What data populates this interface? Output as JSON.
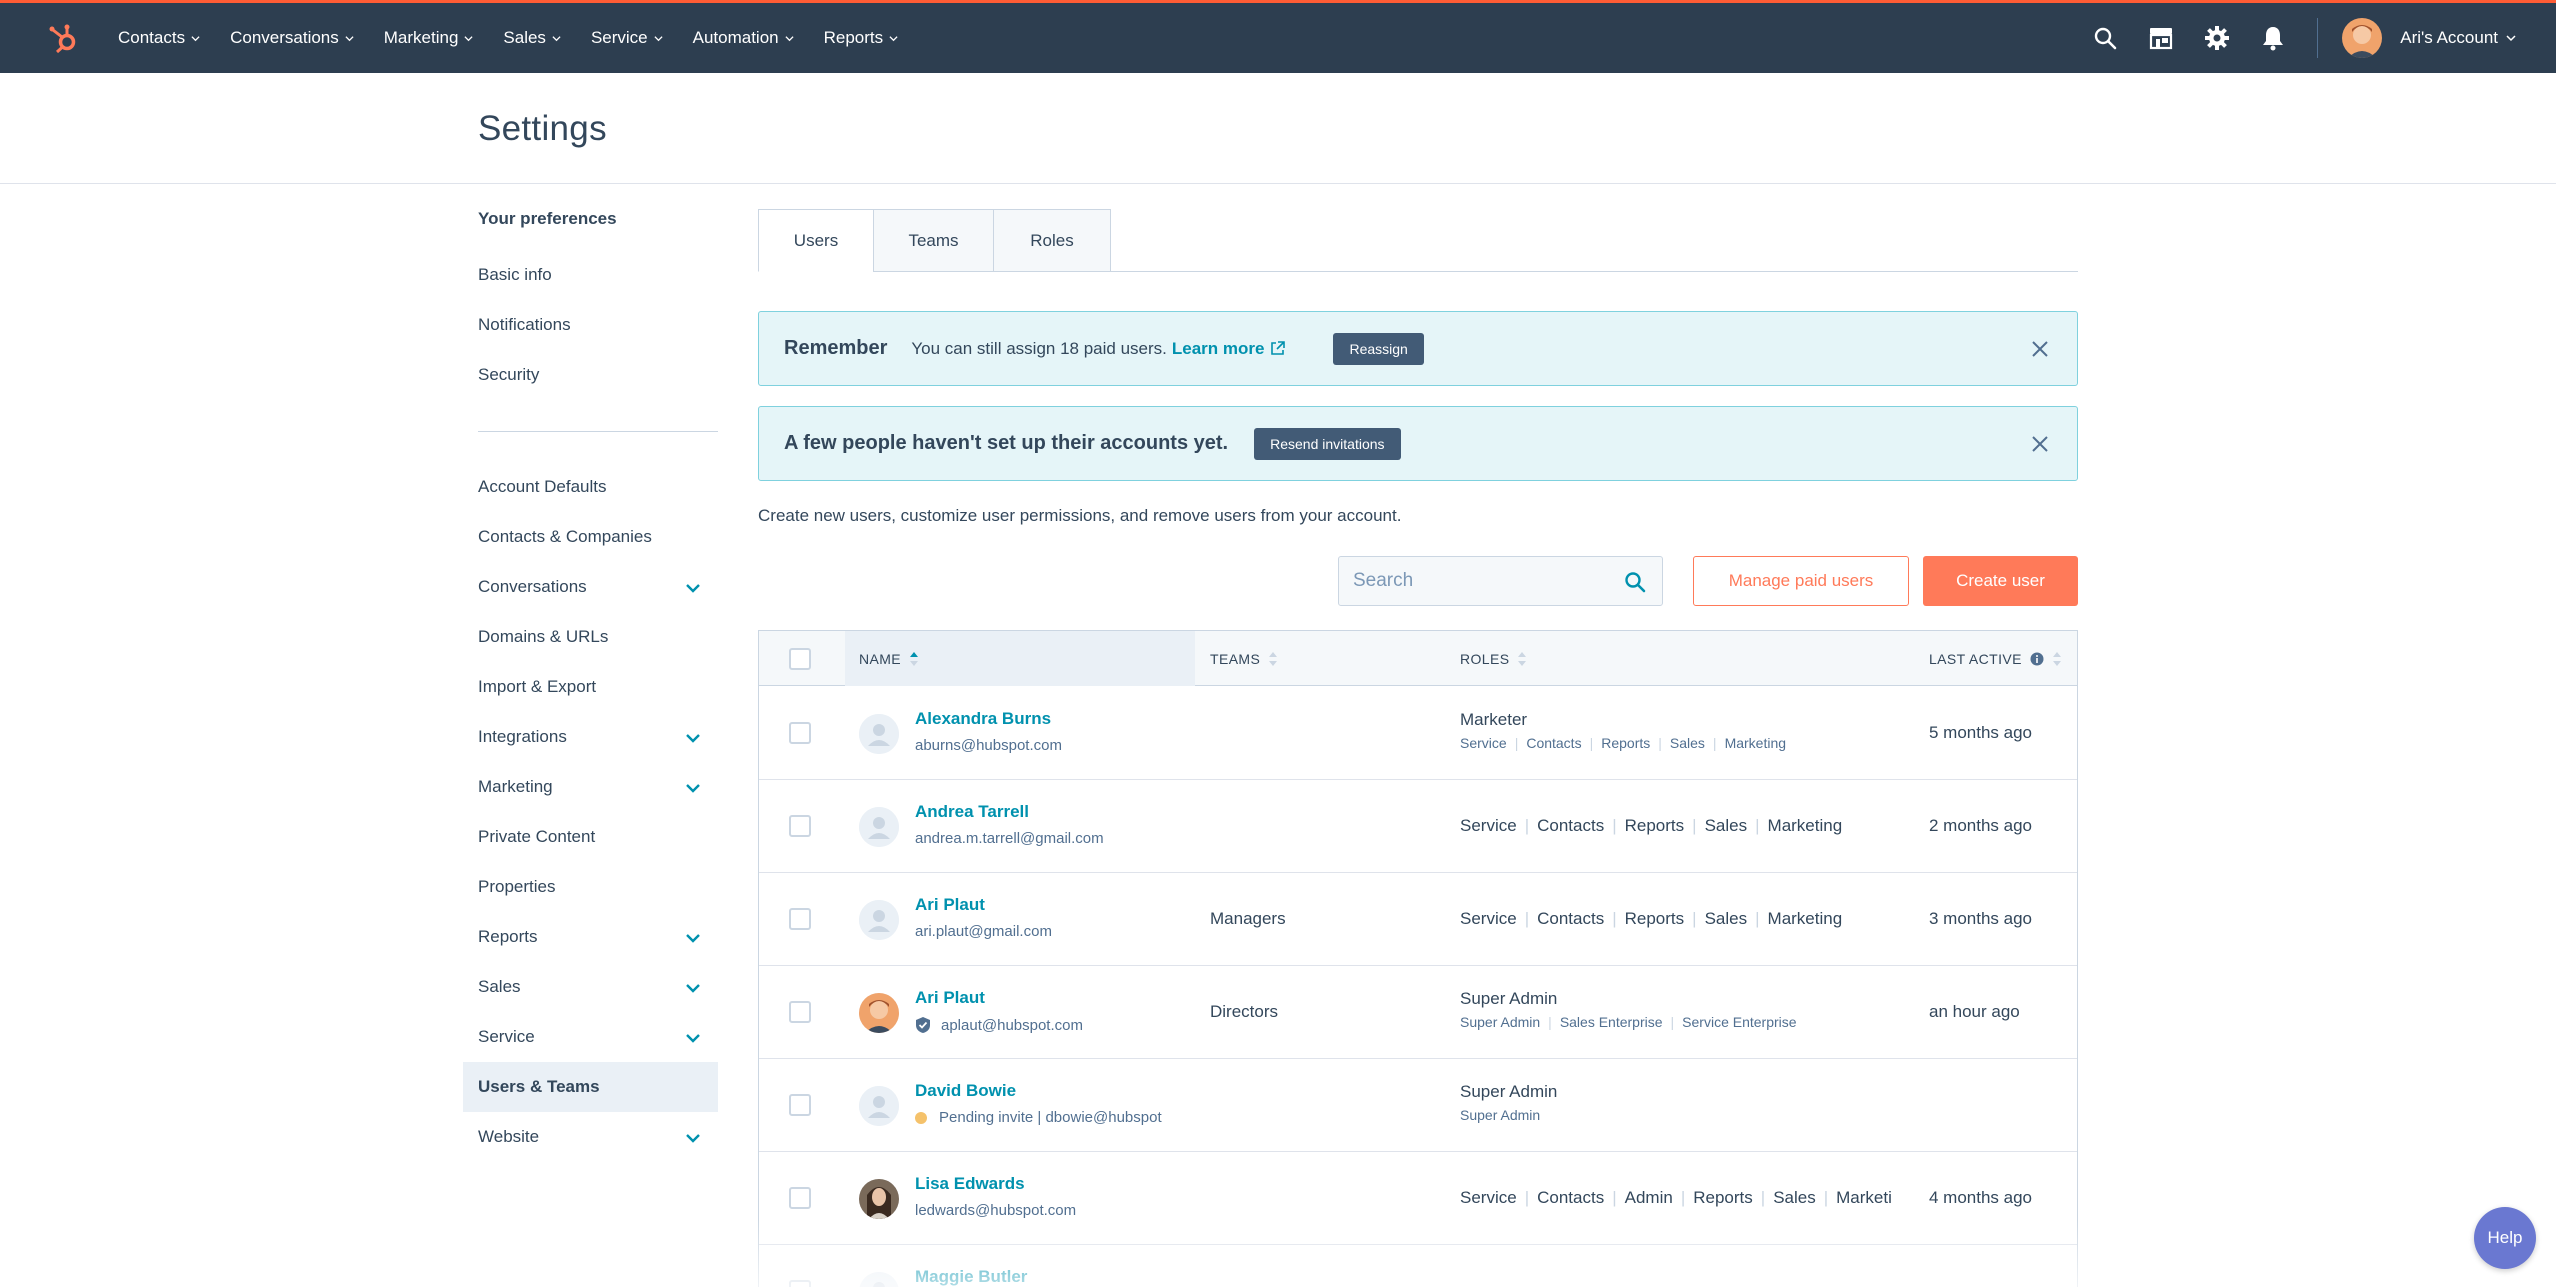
{
  "topnav": {
    "items": [
      "Contacts",
      "Conversations",
      "Marketing",
      "Sales",
      "Service",
      "Automation",
      "Reports"
    ],
    "account_label": "Ari's Account",
    "icons": [
      "search-icon",
      "marketplace-icon",
      "gear-icon",
      "bell-icon"
    ],
    "accent": "#ff5c35",
    "bg": "#2d3e50"
  },
  "page": {
    "title": "Settings"
  },
  "sidebar": {
    "heading": "Your preferences",
    "prefs": [
      "Basic info",
      "Notifications",
      "Security"
    ],
    "items": [
      {
        "label": "Account Defaults",
        "expandable": false
      },
      {
        "label": "Contacts & Companies",
        "expandable": false
      },
      {
        "label": "Conversations",
        "expandable": true
      },
      {
        "label": "Domains & URLs",
        "expandable": false
      },
      {
        "label": "Import & Export",
        "expandable": false
      },
      {
        "label": "Integrations",
        "expandable": true
      },
      {
        "label": "Marketing",
        "expandable": true
      },
      {
        "label": "Private Content",
        "expandable": false
      },
      {
        "label": "Properties",
        "expandable": false
      },
      {
        "label": "Reports",
        "expandable": true
      },
      {
        "label": "Sales",
        "expandable": true
      },
      {
        "label": "Service",
        "expandable": true
      },
      {
        "label": "Users & Teams",
        "expandable": false,
        "active": true
      },
      {
        "label": "Website",
        "expandable": true
      }
    ]
  },
  "tabs": [
    "Users",
    "Teams",
    "Roles"
  ],
  "alerts": {
    "remember": {
      "title": "Remember",
      "text": "You can still assign 18 paid users.",
      "link": "Learn more",
      "button": "Reassign"
    },
    "invites": {
      "title": "A few people haven't set up their accounts yet.",
      "button": "Resend invitations"
    }
  },
  "description": "Create new users, customize user permissions, and remove users from your account.",
  "search": {
    "placeholder": "Search"
  },
  "buttons": {
    "manage": "Manage paid users",
    "create": "Create user"
  },
  "table": {
    "headers": {
      "name": "NAME",
      "teams": "TEAMS",
      "roles": "ROLES",
      "last_active": "LAST ACTIVE"
    },
    "rows": [
      {
        "name": "Alexandra Burns",
        "email": "aburns@hubspot.com",
        "team": "",
        "role_title": "Marketer",
        "roles": [
          "Service",
          "Contacts",
          "Reports",
          "Sales",
          "Marketing"
        ],
        "last_active": "5 months ago",
        "avatar": "default"
      },
      {
        "name": "Andrea Tarrell",
        "email": "andrea.m.tarrell@gmail.com",
        "team": "",
        "role_title": "",
        "roles": [
          "Service",
          "Contacts",
          "Reports",
          "Sales",
          "Marketing"
        ],
        "last_active": "2 months ago",
        "avatar": "default"
      },
      {
        "name": "Ari Plaut",
        "email": "ari.plaut@gmail.com",
        "team": "Managers",
        "role_title": "",
        "roles": [
          "Service",
          "Contacts",
          "Reports",
          "Sales",
          "Marketing"
        ],
        "last_active": "3 months ago",
        "avatar": "default"
      },
      {
        "name": "Ari Plaut",
        "email": "aplaut@hubspot.com",
        "team": "Directors",
        "role_title": "Super Admin",
        "roles": [
          "Super Admin",
          "Sales Enterprise",
          "Service Enterprise"
        ],
        "last_active": "an hour ago",
        "avatar": "photo-man",
        "verified": true
      },
      {
        "name": "David Bowie",
        "email": "Pending invite | dbowie@hubspot",
        "team": "",
        "role_title": "Super Admin",
        "roles": [
          "Super Admin"
        ],
        "last_active": "",
        "avatar": "default",
        "pending": true
      },
      {
        "name": "Lisa Edwards",
        "email": "ledwards@hubspot.com",
        "team": "",
        "role_title": "",
        "roles": [
          "Service",
          "Contacts",
          "Admin",
          "Reports",
          "Sales",
          "Marketi"
        ],
        "last_active": "4 months ago",
        "avatar": "photo-woman"
      },
      {
        "name": "Maggie Butler",
        "email": "",
        "team": "",
        "role_title": "",
        "roles": [],
        "last_active": "",
        "avatar": "default"
      }
    ]
  },
  "help": {
    "label": "Help"
  }
}
